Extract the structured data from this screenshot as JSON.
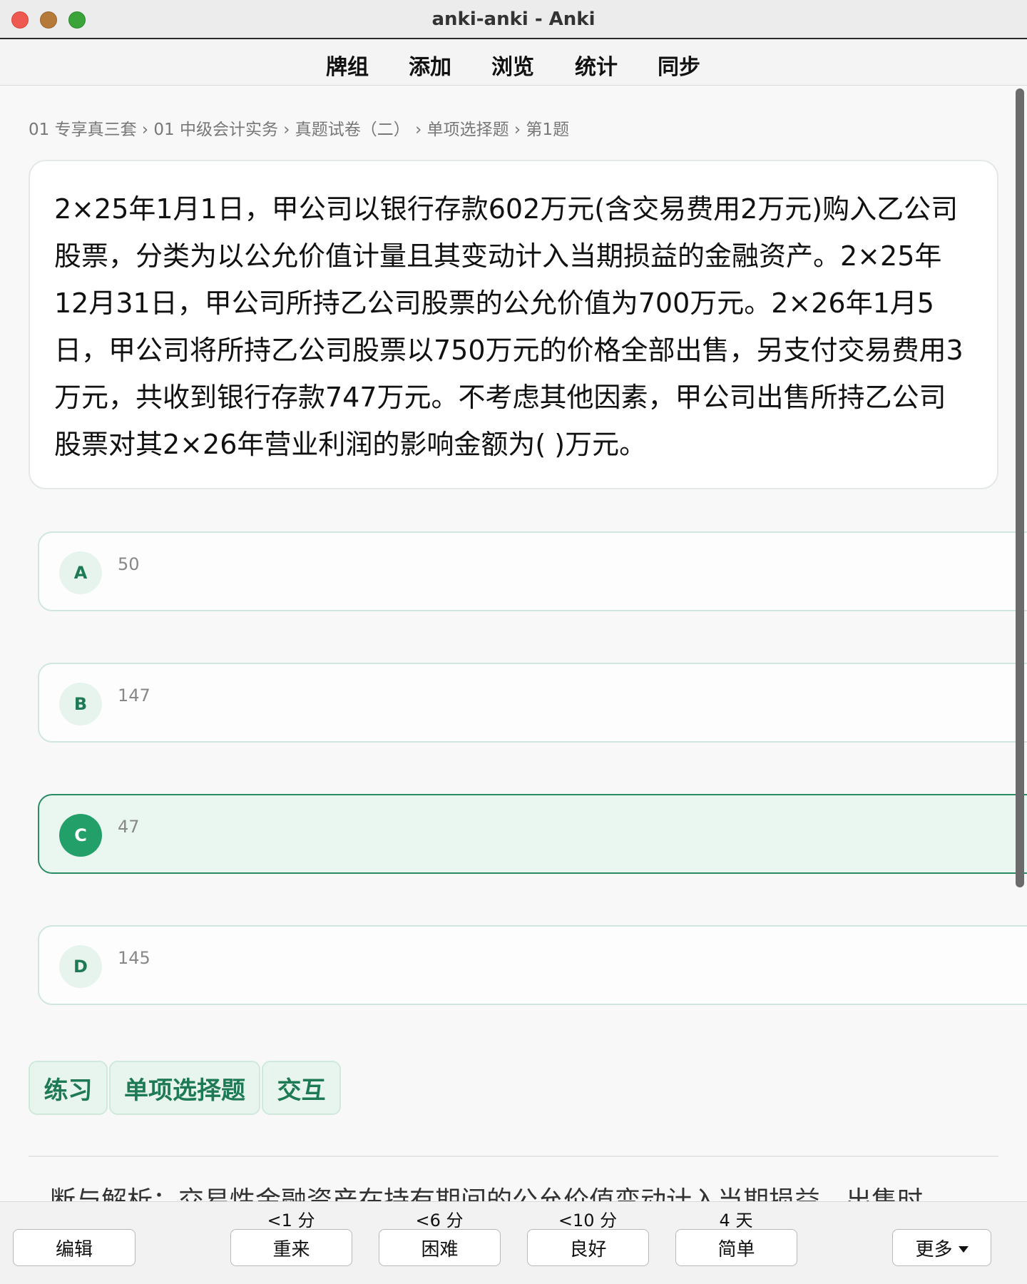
{
  "window": {
    "title": "anki-anki - Anki"
  },
  "toolbar": {
    "items": [
      "牌组",
      "添加",
      "浏览",
      "统计",
      "同步"
    ]
  },
  "breadcrumb": "01 专享真三套 › 01 中级会计实务 › 真题试卷（二） › 单项选择题 › 第1题",
  "question": {
    "text": "2×25年1月1日，甲公司以银行存款602万元(含交易费用2万元)购入乙公司股票，分类为以公允价值计量且其变动计入当期损益的金融资产。2×25年12月31日，甲公司所持乙公司股票的公允价值为700万元。2×26年1月5日，甲公司将所持乙公司股票以750万元的价格全部出售，另支付交易费用3万元，共收到银行存款747万元。不考虑其他因素，甲公司出售所持乙公司股票对其2×26年营业利润的影响金额为( )万元。"
  },
  "options": [
    {
      "letter": "A",
      "value": "50",
      "selected": false
    },
    {
      "letter": "B",
      "value": "147",
      "selected": false
    },
    {
      "letter": "C",
      "value": "47",
      "selected": true
    },
    {
      "letter": "D",
      "value": "145",
      "selected": false
    }
  ],
  "tags": [
    "练习",
    "单项选择题",
    "交互"
  ],
  "analysis_peek": "断与解析：交易性金融资产在持有期间的公允价值变动计入当期损益，出售时…",
  "bottom": {
    "edit": "编辑",
    "answers": [
      {
        "interval": "<1 分",
        "label": "重来"
      },
      {
        "interval": "<6 分",
        "label": "困难"
      },
      {
        "interval": "<10 分",
        "label": "良好"
      },
      {
        "interval": "4 天",
        "label": "简单"
      }
    ],
    "more": "更多"
  }
}
